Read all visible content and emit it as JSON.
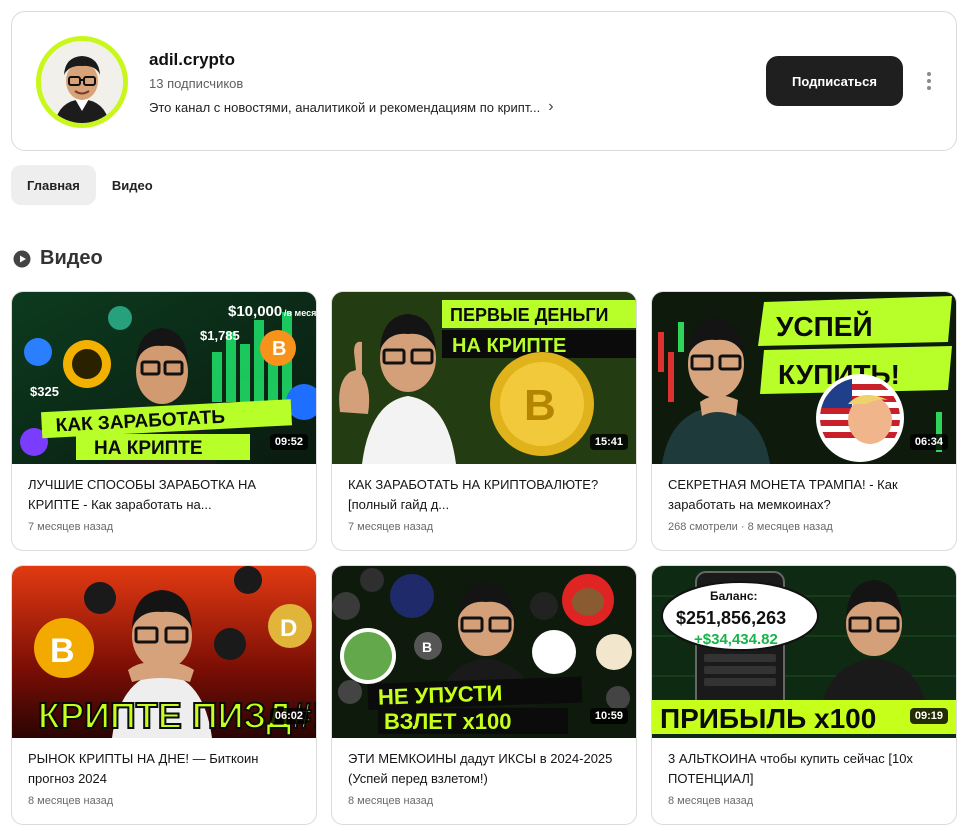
{
  "channel": {
    "name": "adil.crypto",
    "subscribers": "13 подписчиков",
    "description": "Это канал с новостями, аналитикой и рекомендациям по крипт...",
    "subscribe_label": "Подписаться",
    "accent_color": "#c9f71a"
  },
  "tabs": [
    {
      "label": "Главная",
      "active": true
    },
    {
      "label": "Видео",
      "active": false
    }
  ],
  "section": {
    "title": "Видео",
    "icon": "video-icon"
  },
  "videos": [
    {
      "title": "ЛУЧШИЕ СПОСОБЫ ЗАРАБОТКА НА КРИПТЕ - Как заработать на...",
      "meta": "7 месяцев назад",
      "duration": "09:52",
      "thumb_text": [
        "КАК ЗАРАБОТАТЬ",
        "НА КРИПТЕ"
      ],
      "thumb_numbers": [
        "$10,000",
        "/в месяц",
        "$1,785",
        "$325"
      ]
    },
    {
      "title": "КАК ЗАРАБОТАТЬ НА КРИПТОВАЛЮТЕ? [полный гайд д...",
      "meta": "7 месяцев назад",
      "duration": "15:41",
      "thumb_text": [
        "ПЕРВЫЕ ДЕНЬГИ",
        "НА КРИПТЕ"
      ]
    },
    {
      "title": "СЕКРЕТНАЯ МОНЕТА ТРАМПА! - Как заработать на мемкоинах?",
      "meta": "268 смотрели · 8 месяцев назад",
      "duration": "06:34",
      "thumb_text": [
        "УСПЕЙ",
        "КУПИТЬ!"
      ]
    },
    {
      "title": "РЫНОК КРИПТЫ НА ДНЕ! — Биткоин прогноз 2024",
      "meta": "8 месяцев назад",
      "duration": "06:02",
      "thumb_text": [
        "КРИПТЕ ПИЗД#!"
      ]
    },
    {
      "title": "ЭТИ МЕМКОИНЫ дадут ИКСЫ в 2024-2025 (Успей перед взлетом!)",
      "meta": "8 месяцев назад",
      "duration": "10:59",
      "thumb_text": [
        "НЕ УПУСТИ",
        "ВЗЛЕТ х100"
      ]
    },
    {
      "title": "3 АЛЬТКОИНА чтобы купить сейчас [10x ПОТЕНЦИАЛ]",
      "meta": "8 месяцев назад",
      "duration": "09:19",
      "thumb_text": [
        "ПРИБЫЛЬ х100"
      ],
      "thumb_numbers": [
        "Баланс:",
        "$251,856,263",
        "+$34,434.82"
      ]
    }
  ]
}
